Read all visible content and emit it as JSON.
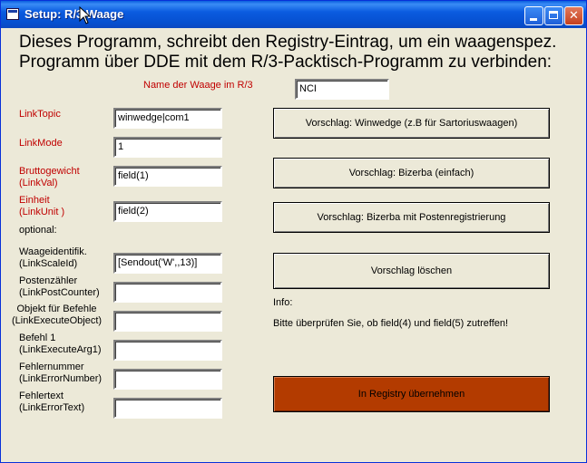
{
  "window": {
    "title": "Setup: R/3 Waage"
  },
  "heading": {
    "line1": "Dieses Programm, schreibt den Registry-Eintrag, um ein waagenspez.",
    "line2": "Programm über DDE mit dem R/3-Packtisch-Programm zu verbinden:"
  },
  "scale_name": {
    "label": "Name der Waage im R/3",
    "value": "NCI"
  },
  "fields": {
    "link_topic": {
      "label": "LinkTopic",
      "value": "winwedge|com1"
    },
    "link_mode": {
      "label": "LinkMode",
      "value": "1"
    },
    "brutto": {
      "label1": "Bruttogewicht",
      "label2": "(LinkVal)",
      "value": "field(1)"
    },
    "einheit": {
      "label1": "Einheit",
      "label2": "(LinkUnit )",
      "value": "field(2)"
    },
    "optional_label": "optional:",
    "waagenident": {
      "label1": "Waageidentifik.",
      "label2": "(LinkScaleId)",
      "value": "[Sendout('W',,13)]"
    },
    "posten": {
      "label1": "Postenzähler",
      "label2": "(LinkPostCounter)",
      "value": ""
    },
    "objekt": {
      "label1": "Objekt für Befehle",
      "label2": "(LinkExecuteObject)",
      "value": ""
    },
    "befehl": {
      "label1": "Befehl 1",
      "label2": "(LinkExecuteArg1)",
      "value": ""
    },
    "fehlernummer": {
      "label1": "Fehlernummer",
      "label2": "(LinkErrorNumber)",
      "value": ""
    },
    "fehlertext": {
      "label1": "Fehlertext",
      "label2": "(LinkErrorText)",
      "value": ""
    }
  },
  "buttons": {
    "winwedge": "Vorschlag: Winwedge (z.B für Sartoriuswaagen)",
    "bizerba": "Vorschlag: Bizerba (einfach)",
    "bizerba_posten": "Vorschlag: Bizerba mit Postenregistrierung",
    "delete": "Vorschlag löschen",
    "apply": "In Registry übernehmen"
  },
  "info": {
    "label": "Info:",
    "text": "Bitte überprüfen Sie, ob field(4) und field(5) zutreffen!"
  },
  "colors": {
    "label_red": "#c00000",
    "apply_button": "#b33b00",
    "titlebar": "#0a5fde"
  },
  "icons": [
    "app-window-icon",
    "minimize-icon",
    "maximize-icon",
    "close-icon",
    "mouse-cursor-icon"
  ]
}
